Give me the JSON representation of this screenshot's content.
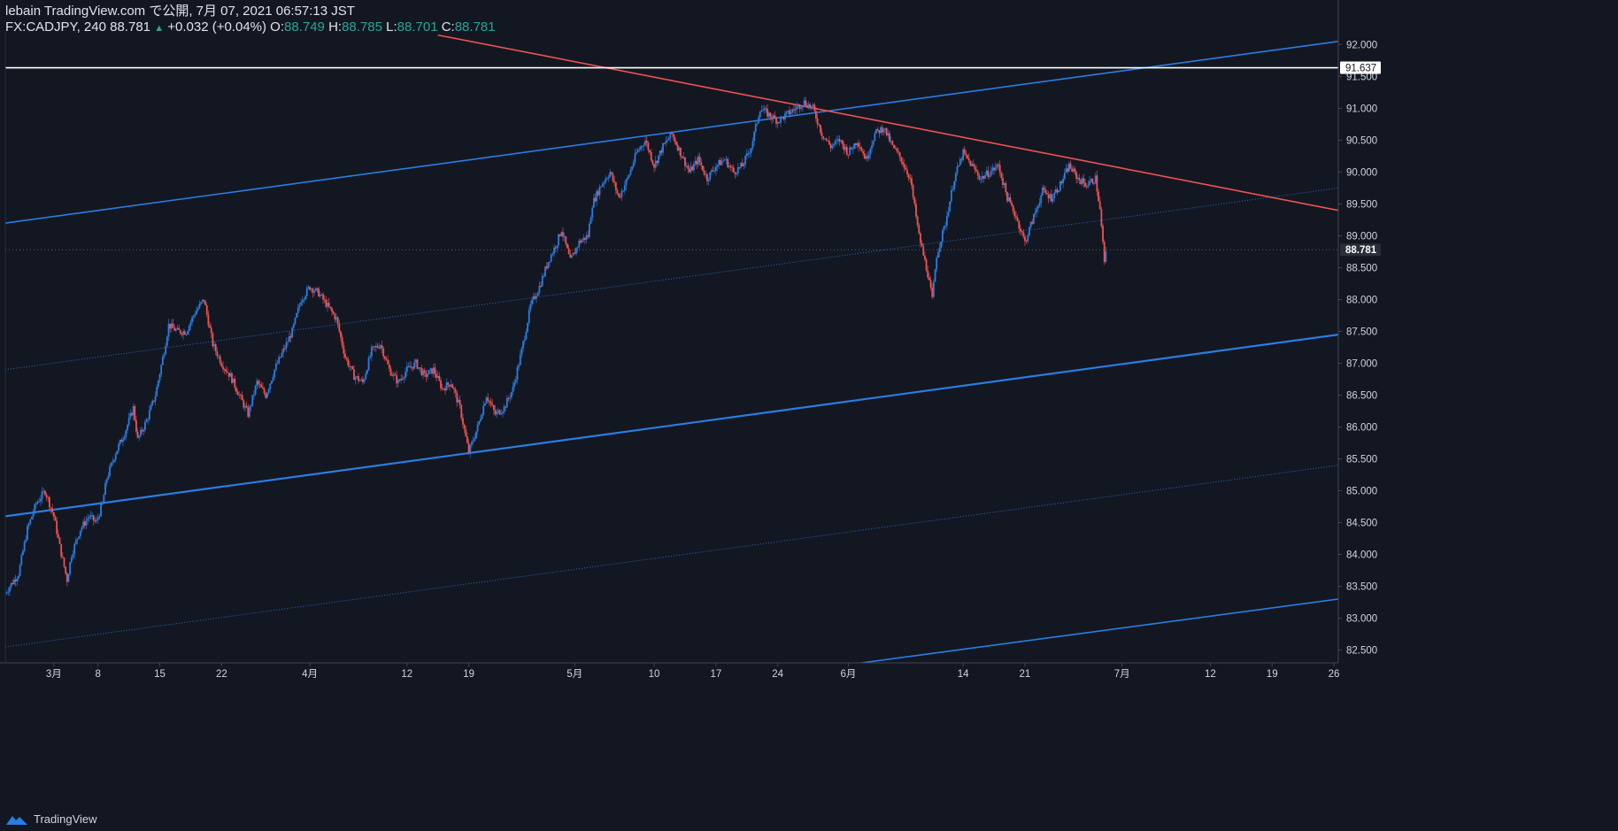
{
  "header": {
    "publish_line": "lebain TradingView.com で公開, 7月 07, 2021 06:57:13 JST",
    "symbol": "FX:CADJPY, 240",
    "last": "88.781",
    "change": "+0.032 (+0.04%)",
    "o_label": "O:",
    "o_value": "88.749",
    "h_label": "H:",
    "h_value": "88.785",
    "l_label": "L:",
    "l_value": "88.701",
    "c_label": "C:",
    "c_value": "88.781"
  },
  "footer": {
    "brand": "TradingView"
  },
  "colors": {
    "background": "#131722",
    "up": "#2a7de1",
    "down": "#ef5350",
    "channel": "#2a7de1",
    "trendline": "#ef5350",
    "resistance": "#ffffff",
    "axis_text": "#d1d4dc"
  },
  "chart_data": {
    "type": "candlestick",
    "symbol": "FX:CADJPY",
    "timeframe": "240",
    "y_ticks": [
      "82.500",
      "83.000",
      "83.500",
      "84.000",
      "84.500",
      "85.000",
      "85.500",
      "86.000",
      "86.500",
      "87.000",
      "87.500",
      "88.000",
      "88.500",
      "89.000",
      "89.500",
      "90.000",
      "90.500",
      "91.000",
      "91.500",
      "92.000"
    ],
    "ylim": [
      82.3,
      92.2
    ],
    "x_ticks": [
      {
        "label": "3月",
        "day": -3
      },
      {
        "label": "8",
        "day": 2
      },
      {
        "label": "15",
        "day": 9
      },
      {
        "label": "22",
        "day": 16
      },
      {
        "label": "4月",
        "day": 26
      },
      {
        "label": "12",
        "day": 37
      },
      {
        "label": "19",
        "day": 44
      },
      {
        "label": "5月",
        "day": 56
      },
      {
        "label": "10",
        "day": 65
      },
      {
        "label": "17",
        "day": 72
      },
      {
        "label": "24",
        "day": 79
      },
      {
        "label": "6月",
        "day": 87
      },
      {
        "label": "14",
        "day": 100
      },
      {
        "label": "21",
        "day": 107
      },
      {
        "label": "7月",
        "day": 118
      },
      {
        "label": "12",
        "day": 128
      },
      {
        "label": "19",
        "day": 135
      },
      {
        "label": "26",
        "day": 142
      }
    ],
    "xlim": [
      -8.5,
      142.5
    ],
    "price_path": [
      [
        -8.5,
        83.4
      ],
      [
        -7,
        83.7
      ],
      [
        -6,
        84.4
      ],
      [
        -5,
        84.8
      ],
      [
        -4,
        85.0
      ],
      [
        -3,
        84.6
      ],
      [
        -2.3,
        84.1
      ],
      [
        -1.5,
        83.6
      ],
      [
        -1,
        84.0
      ],
      [
        0,
        84.4
      ],
      [
        1,
        84.6
      ],
      [
        1.8,
        84.5
      ],
      [
        2.5,
        84.8
      ],
      [
        3,
        85.2
      ],
      [
        4,
        85.6
      ],
      [
        5,
        85.9
      ],
      [
        6,
        86.3
      ],
      [
        6.5,
        85.8
      ],
      [
        7.5,
        86.1
      ],
      [
        8.5,
        86.5
      ],
      [
        9.5,
        87.2
      ],
      [
        10,
        87.6
      ],
      [
        11,
        87.5
      ],
      [
        12,
        87.5
      ],
      [
        13,
        87.8
      ],
      [
        14,
        88.0
      ],
      [
        15,
        87.3
      ],
      [
        16,
        87.0
      ],
      [
        17,
        86.8
      ],
      [
        18,
        86.5
      ],
      [
        19,
        86.2
      ],
      [
        20,
        86.7
      ],
      [
        21,
        86.5
      ],
      [
        22,
        86.9
      ],
      [
        23,
        87.2
      ],
      [
        24,
        87.5
      ],
      [
        25,
        88.0
      ],
      [
        26,
        88.2
      ],
      [
        27,
        88.1
      ],
      [
        28,
        87.9
      ],
      [
        29,
        87.7
      ],
      [
        30,
        87.1
      ],
      [
        31,
        86.8
      ],
      [
        32,
        86.7
      ],
      [
        33,
        87.2
      ],
      [
        34,
        87.3
      ],
      [
        35,
        86.9
      ],
      [
        36,
        86.7
      ],
      [
        37,
        86.9
      ],
      [
        38,
        87.0
      ],
      [
        39,
        86.8
      ],
      [
        40,
        86.9
      ],
      [
        41,
        86.6
      ],
      [
        42,
        86.7
      ],
      [
        43,
        86.3
      ],
      [
        44,
        85.6
      ],
      [
        45,
        86.0
      ],
      [
        46,
        86.5
      ],
      [
        47,
        86.2
      ],
      [
        48,
        86.3
      ],
      [
        49,
        86.6
      ],
      [
        50,
        87.2
      ],
      [
        51,
        87.9
      ],
      [
        52,
        88.2
      ],
      [
        53,
        88.6
      ],
      [
        54,
        88.9
      ],
      [
        54.5,
        89.1
      ],
      [
        55.5,
        88.6
      ],
      [
        56.5,
        88.9
      ],
      [
        57.5,
        89.0
      ],
      [
        58,
        89.5
      ],
      [
        59,
        89.8
      ],
      [
        60,
        90.0
      ],
      [
        61,
        89.6
      ],
      [
        62,
        89.9
      ],
      [
        63,
        90.3
      ],
      [
        64,
        90.5
      ],
      [
        65,
        90.1
      ],
      [
        66,
        90.4
      ],
      [
        67,
        90.6
      ],
      [
        68,
        90.3
      ],
      [
        69,
        90.0
      ],
      [
        70,
        90.2
      ],
      [
        71,
        89.9
      ],
      [
        72,
        90.1
      ],
      [
        73,
        90.2
      ],
      [
        74,
        90.0
      ],
      [
        75,
        90.1
      ],
      [
        76,
        90.4
      ],
      [
        77,
        91.0
      ],
      [
        78,
        90.9
      ],
      [
        79,
        90.8
      ],
      [
        80,
        90.9
      ],
      [
        81,
        91.0
      ],
      [
        82,
        91.1
      ],
      [
        83,
        91.0
      ],
      [
        84,
        90.6
      ],
      [
        85,
        90.4
      ],
      [
        86,
        90.5
      ],
      [
        87,
        90.3
      ],
      [
        88,
        90.5
      ],
      [
        89,
        90.2
      ],
      [
        90,
        90.6
      ],
      [
        91,
        90.7
      ],
      [
        92,
        90.4
      ],
      [
        93,
        90.2
      ],
      [
        94,
        89.9
      ],
      [
        95,
        89.0
      ],
      [
        96,
        88.4
      ],
      [
        96.5,
        88.0
      ],
      [
        97,
        88.7
      ],
      [
        98,
        89.2
      ],
      [
        99,
        89.9
      ],
      [
        100,
        90.3
      ],
      [
        101,
        90.1
      ],
      [
        102,
        89.9
      ],
      [
        103,
        90.0
      ],
      [
        104,
        90.1
      ],
      [
        105,
        89.6
      ],
      [
        106,
        89.3
      ],
      [
        107,
        88.9
      ],
      [
        108,
        89.3
      ],
      [
        109,
        89.7
      ],
      [
        110,
        89.6
      ],
      [
        111,
        89.8
      ],
      [
        112,
        90.1
      ],
      [
        113,
        89.9
      ],
      [
        114,
        89.8
      ],
      [
        115,
        89.9
      ],
      [
        115.5,
        89.4
      ],
      [
        116,
        88.6
      ],
      [
        116.3,
        88.78
      ]
    ],
    "lines": [
      {
        "name": "channel-upper",
        "type": "solid",
        "points": [
          [
            -8.5,
            89.2
          ],
          [
            142.5,
            92.05
          ]
        ]
      },
      {
        "name": "channel-middle",
        "type": "dotted",
        "points": [
          [
            -8.5,
            86.9
          ],
          [
            142.5,
            89.75
          ]
        ]
      },
      {
        "name": "channel-lower",
        "type": "solid",
        "points": [
          [
            -8.5,
            84.6
          ],
          [
            142.5,
            87.45
          ]
        ]
      },
      {
        "name": "channel-lower-2",
        "type": "dotted",
        "points": [
          [
            -8.5,
            82.55
          ],
          [
            142.5,
            85.4
          ]
        ]
      },
      {
        "name": "channel-lower-3",
        "type": "solid",
        "points": [
          [
            88.5,
            82.3
          ],
          [
            142.5,
            83.3
          ]
        ]
      },
      {
        "name": "descending-trendline",
        "type": "solid",
        "points": [
          [
            40.5,
            92.15
          ],
          [
            142.5,
            89.4
          ]
        ]
      }
    ],
    "horizontal_level": {
      "value": 91.637,
      "label": "91.637"
    },
    "last_price": {
      "value": 88.781,
      "label": "88.781"
    }
  }
}
